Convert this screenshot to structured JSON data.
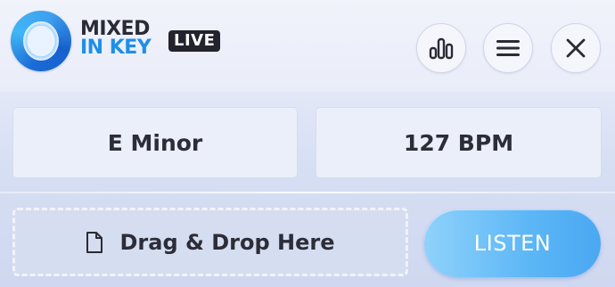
{
  "window": {
    "title": "Mixed In Key Live"
  },
  "logo": {
    "line1": "MIXED",
    "line2": "IN KEY",
    "badge": "LIVE",
    "icon": "mixed-in-key-ring-logo"
  },
  "toolbar": {
    "stats_icon": "bar-chart-icon",
    "menu_icon": "hamburger-menu-icon",
    "close_icon": "close-icon"
  },
  "analysis": {
    "key": "E Minor",
    "bpm": "127 BPM"
  },
  "dropzone": {
    "icon": "document-icon",
    "label": "Drag & Drop Here"
  },
  "listen": {
    "label": "LISTEN"
  },
  "colors": {
    "accent": "#5cb6f6",
    "brand_blue": "#1f8fe8",
    "text": "#2c2d38"
  }
}
